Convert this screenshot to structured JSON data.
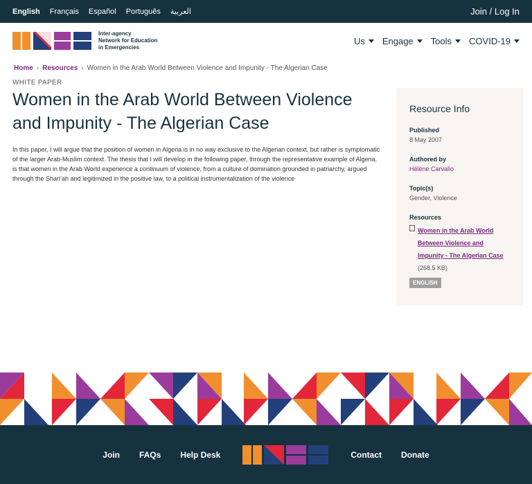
{
  "languages": [
    "English",
    "Français",
    "Español",
    "Português",
    "العربية"
  ],
  "login_label": "Join / Log In",
  "logo_text": [
    "Inter-agency",
    "Network for Education",
    "in Emergencies"
  ],
  "nav": [
    "Us",
    "Engage",
    "Tools",
    "COVID-19"
  ],
  "breadcrumb": {
    "home": "Home",
    "resources": "Resources",
    "current": "Women in the Arab World Between Violence and Impunity - The Algerian Case"
  },
  "main": {
    "kicker": "WHITE PAPER",
    "title": "Women in the Arab World Between Violence and Impunity - The Algerian Case",
    "description": "In this paper, I will argue that the position of women in Algeria is in no way exclusive to the Algerian context, but rather is symptomatic of the larger Arab-Muslim context. The thesis that I will develop in the following paper, through the representative example of Algeria, is that women in the Arab World experience a continuum of violence, from a culture of domination grounded in patriarchy, argued through the Shari’ah and legitimized in the positive law, to a political instrumentalization of the violence"
  },
  "sidebar": {
    "title": "Resource Info",
    "published_label": "Published",
    "published_value": "8 May 2007",
    "authored_label": "Authored by",
    "authored_value": "Hélène Carvallo",
    "topics_label": "Topic(s)",
    "topics_value": "Gender, Violence",
    "resources_label": "Resources",
    "resource_link": "Women in the Arab World Between Violence and Impunity - The Algerian Case",
    "resource_size": "(268.5 KB)",
    "language_badge": "ENGLISH"
  },
  "footer": [
    "Join",
    "FAQs",
    "Help Desk",
    "Contact",
    "Donate"
  ],
  "colors": {
    "navy": "#17323f",
    "purple": "#7a2c81",
    "orange": "#f18f2e",
    "red": "#e3263a",
    "blue": "#24407b",
    "magenta": "#9b3b9c"
  }
}
